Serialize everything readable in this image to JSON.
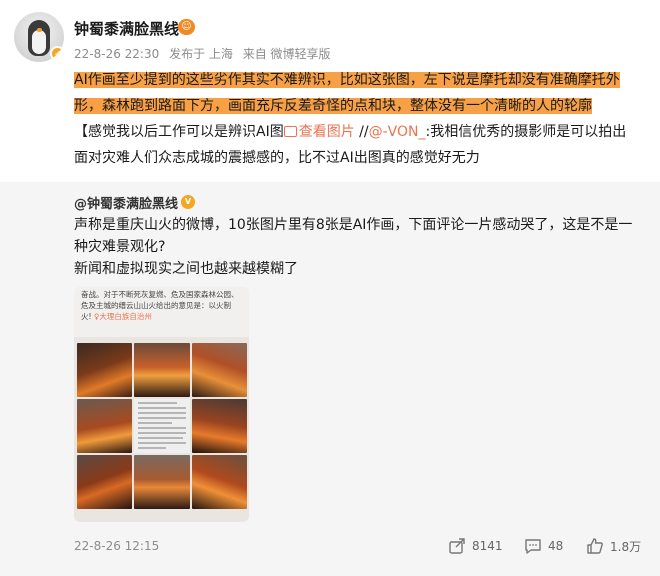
{
  "post": {
    "username": "钟蜀黍满脸黑线",
    "meta": {
      "time": "22-8-26 22:30",
      "from": "发布于 上海",
      "source": "来自 微博轻享版"
    },
    "highlight_text": "AI作画至少提到的这些劣作其实不难辨识，比如这张图，左下说是摩托却没有准确摩托外形，森林跑到路面下方，画面充斥反差奇怪的点和块，整体没有一个清晰的人的轮廓",
    "text_before_link": "【感觉我以后工作可以是辨识AI图",
    "view_image_label": "查看图片",
    "mention_prefix": " //",
    "mention": "@-VON_",
    "text_after_mention": ":我相信优秀的摄影师是可以拍出面对灾难人们众志成城的震撼感的，比不过AI出图真的感觉好无力"
  },
  "retweet": {
    "username": "@钟蜀黍满脸黑线",
    "line1": "声称是重庆山火的微博，10张图片里有8张是AI作画，下面评论一片感动哭了，这是不是一种灾难景观化?",
    "line2": "新闻和虚拟现实之间也越来越模糊了",
    "image_text": "奋战。对于不断死灰复燃、危及国家森林公园、危及主城的缙云山山火给出的意见是：以火制火!",
    "image_location": "♀大理白族自治州",
    "date": "22-8-26 12:15",
    "actions": {
      "repost": "8141",
      "comment": "48",
      "like": "1.8万"
    }
  },
  "colors": {
    "highlight": "#f7a046",
    "link": "#eb7350",
    "meta": "#8c8c8c"
  },
  "icons": [
    "vip-badge-icon",
    "verified-badge-icon",
    "image-icon",
    "share-icon",
    "comment-icon",
    "like-icon"
  ]
}
